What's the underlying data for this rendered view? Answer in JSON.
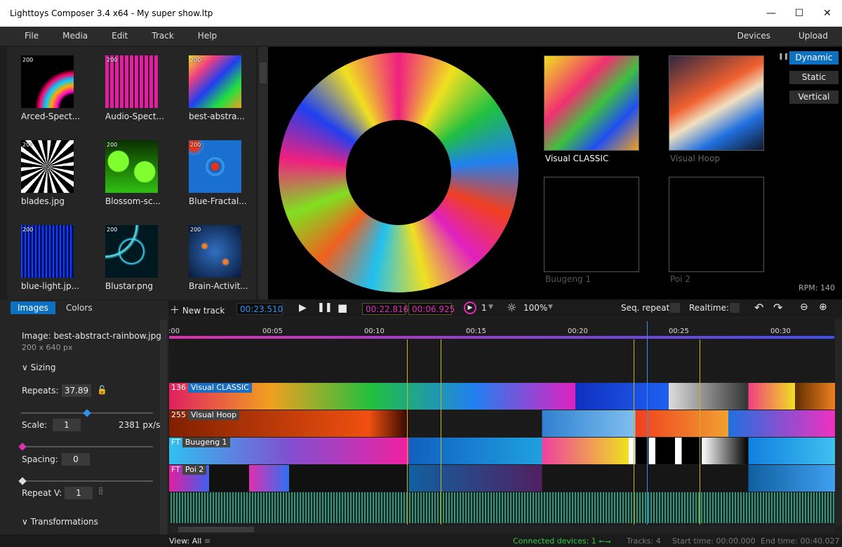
{
  "window": {
    "title": "Lighttoys Composer 3.4 x64 - My super show.ltp",
    "minimize": "—",
    "maximize": "☐",
    "close": "✕"
  },
  "menu": {
    "items": [
      "File",
      "Media",
      "Edit",
      "Track",
      "Help"
    ],
    "right": [
      "Devices",
      "Upload"
    ]
  },
  "library": {
    "badge": "200",
    "items": [
      {
        "label": "Arced-Spect..."
      },
      {
        "label": "Audio-Spect..."
      },
      {
        "label": "best-abstra..."
      },
      {
        "label": "blades.jpg"
      },
      {
        "label": "Blossom-sc..."
      },
      {
        "label": "Blue-Fractal..."
      },
      {
        "label": "blue-light.jp..."
      },
      {
        "label": "Blustar.png"
      },
      {
        "label": "Brain-Activit..."
      }
    ]
  },
  "preview": {
    "slots": [
      {
        "label": "Visual CLASSIC",
        "active": true
      },
      {
        "label": "Visual Hoop",
        "active": false
      },
      {
        "label": "Buugeng 1",
        "active": false
      },
      {
        "label": "Poi 2",
        "active": false
      }
    ],
    "modes": [
      "Dynamic",
      "Static",
      "Vertical"
    ],
    "pause_icon": "pause-icon",
    "rpm": "RPM: 140"
  },
  "panel": {
    "tabs": [
      "Images",
      "Colors"
    ],
    "image_name": "Image: best-abstract-rainbow.jpg",
    "image_size": "200 x 640 px",
    "sizing": "Sizing",
    "repeats_label": "Repeats:",
    "repeats": "37.89",
    "scale_label": "Scale:",
    "scale": "1",
    "scale_unit": "2381 px/s",
    "spacing_label": "Spacing:",
    "spacing": "0",
    "repeatv_label": "Repeat V:",
    "repeatv": "1",
    "transformations": "Transformations"
  },
  "transport": {
    "new_track": "New track",
    "position": "00:23.510",
    "sel_start": "00:22.816",
    "sel_len": "00:06.925",
    "play_count": "1",
    "brightness": "100%",
    "seq_repeat": "Seq. repeat:",
    "realtime": "Realtime:"
  },
  "ruler": {
    "ticks": [
      ":00",
      "00:05",
      "00:10",
      "00:15",
      "00:20",
      "00:25",
      "00:30"
    ]
  },
  "tracks": [
    {
      "num": "136",
      "name": "Visual CLASSIC"
    },
    {
      "num": "255",
      "name": "Visual Hoop"
    },
    {
      "num": "FT",
      "name": "Buugeng 1"
    },
    {
      "num": "FT",
      "name": "Poi 2"
    }
  ],
  "status": {
    "view": "View: All",
    "connected": "Connected devices: 1",
    "tracks": "Tracks: 4",
    "start": "Start time: 00:00.000",
    "end": "End time: 00:40.027"
  },
  "colors": {
    "accent": "#0e70c0",
    "marker": "#c8b820",
    "connected": "#2ecc40",
    "magenta": "#e030b0"
  }
}
